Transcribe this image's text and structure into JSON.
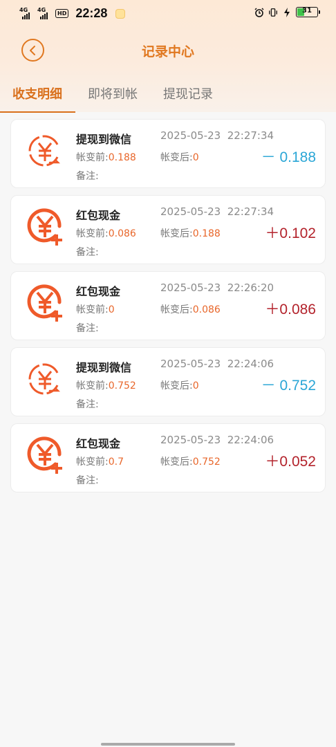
{
  "status_bar": {
    "signal_1": "4G",
    "signal_2": "4G",
    "hd_badge": "HD",
    "time": "22:28",
    "battery_level": "31"
  },
  "header": {
    "title": "记录中心"
  },
  "tabs": [
    {
      "label": "收支明细",
      "active": true
    },
    {
      "label": "即将到帐",
      "active": false
    },
    {
      "label": "提现记录",
      "active": false
    }
  ],
  "labels": {
    "before": "帐变前:",
    "after": "帐变后:",
    "note": "备注:"
  },
  "records": [
    {
      "title": "提现到微信",
      "type": "withdraw",
      "datetime": "2025-05-23  22:27:34",
      "before": "0.188",
      "after": "0",
      "amount": "－ 0.188"
    },
    {
      "title": "红包现金",
      "type": "income",
      "datetime": "2025-05-23  22:27:34",
      "before": "0.086",
      "after": "0.188",
      "amount": "＋0.102"
    },
    {
      "title": "红包现金",
      "type": "income",
      "datetime": "2025-05-23  22:26:20",
      "before": "0",
      "after": "0.086",
      "amount": "＋0.086"
    },
    {
      "title": "提现到微信",
      "type": "withdraw",
      "datetime": "2025-05-23  22:24:06",
      "before": "0.752",
      "after": "0",
      "amount": "－ 0.752"
    },
    {
      "title": "红包现金",
      "type": "income",
      "datetime": "2025-05-23  22:24:06",
      "before": "0.7",
      "after": "0.752",
      "amount": "＋0.052"
    }
  ],
  "colors": {
    "accent": "#e07820",
    "minus": "#2aa6d6",
    "plus": "#b3222b",
    "icon": "#ef5a2a"
  }
}
